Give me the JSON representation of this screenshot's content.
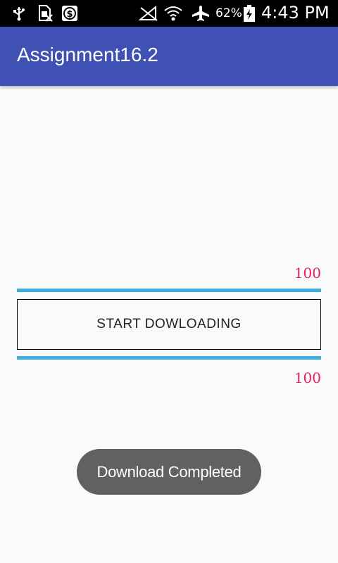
{
  "status_bar": {
    "battery_percent": "62%",
    "time": "4:43 PM",
    "icons": [
      "usb-icon",
      "sim-card-off-icon",
      "app-notification-icon",
      "no-signal-icon",
      "wifi-icon",
      "airplane-mode-icon",
      "battery-charging-icon"
    ]
  },
  "app_bar": {
    "title": "Assignment16.2",
    "color": "#3f51b5"
  },
  "progress_top": {
    "label": "100",
    "value": 100,
    "max": 100
  },
  "start_button": {
    "label": "START DOWLOADING"
  },
  "progress_bottom": {
    "label": "100",
    "value": 100,
    "max": 100
  },
  "toast": {
    "message": "Download Completed"
  },
  "colors": {
    "accent": "#e91e63",
    "progress": "#3fb0e0",
    "toast_bg": "#616161"
  }
}
